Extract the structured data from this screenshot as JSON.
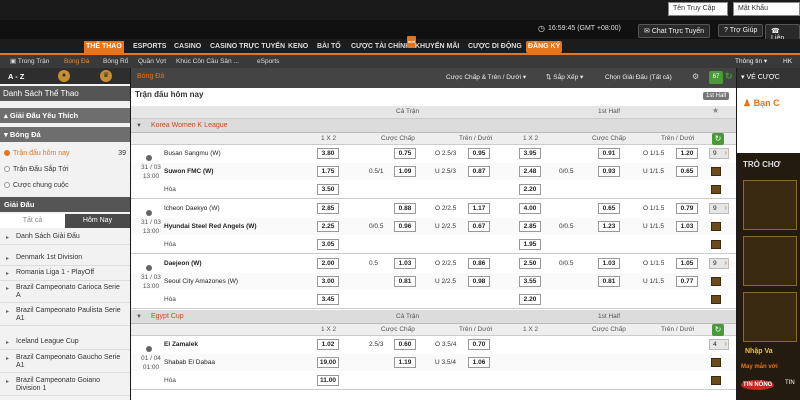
{
  "top": {
    "username_placeholder": "Tên Truy Cập",
    "password_placeholder": "Mật Khẩu",
    "clock": "16:59:45 (GMT +08:00)",
    "live_chat": "Chat Trực Tuyến",
    "help": "Trợ Giúp",
    "contact": "Liên Hệ"
  },
  "nav": {
    "items": [
      "THỂ THAO",
      "ESPORTS",
      "CASINO",
      "CASINO TRỰC TUYẾN",
      "KENO",
      "BÀI TỐ",
      "CƯỢC TÀI CHÍNH",
      "KHUYẾN MÃI",
      "CƯỢC DI ĐỘNG",
      "ĐĂNG KÝ"
    ],
    "new_badge": "mới"
  },
  "subnav": {
    "items": [
      "Trong Trận",
      "Bóng Đá",
      "Bóng Rổ",
      "Quần Vợt",
      "Khúc Côn Cầu Sân ...",
      "eSports"
    ],
    "info": "Thông tin",
    "odds_type": "HK"
  },
  "sidebar": {
    "az": "A - Z",
    "title": "Danh Sách Thể Thao",
    "favorites": "Giải Đấu Yêu Thích",
    "sport": "Bóng Đá",
    "options": [
      {
        "label": "Trận đấu hôm nay",
        "count": "39"
      },
      {
        "label": "Trận Đấu Sắp Tới",
        "count": ""
      },
      {
        "label": "Cược chung cuộc",
        "count": ""
      }
    ],
    "league_section": "Giải Đấu",
    "tabs": [
      "Tất cả",
      "Hôm Nay"
    ],
    "leagues": [
      "Danh Sách Giải Đấu",
      "Denmark 1st Division",
      "Romania Liga 1 - PlayOff",
      "Brazil Campeonato Carioca Serie A",
      "Brazil Campeonato Paulista Serie A1",
      "Iceland League Cup",
      "Brazil Campeonato Gaucho Serie A1",
      "Brazil Campeonato Goiano Division 1"
    ]
  },
  "main": {
    "sport_title": "Bóng Đá",
    "market_select": "Cược Chấp & Trên / Dưới",
    "sort": "Sắp Xếp",
    "league_select": "Chọn Giải Đấu (Tất cả)",
    "count_badge": "67",
    "day_title": "Trận đấu hôm nay",
    "half_btn": "1st Half",
    "full_time": "Cả Trận",
    "first_half": "1st Half",
    "cols": [
      "1 X 2",
      "Cược Chấp",
      "Trên / Dưới",
      "1 X 2",
      "Cược Chấp",
      "Trên / Dưới"
    ],
    "leagues": [
      {
        "name": "Korea Women K League",
        "matches": [
          {
            "date": "31 / 03",
            "time": "13:00",
            "home": "Busan Sangmu (W)",
            "away": "Suwon FMC (W)",
            "fav": "away",
            "ft1": "3.80",
            "ft2": "1.75",
            "ftx": "3.50",
            "fthcp": "0.5/1",
            "fthcp_h": "0.75",
            "fthcp_a": "1.09",
            "ftou": "2.5/3",
            "ftou_o": "0.95",
            "ftou_u": "0.87",
            "h1": "3.95",
            "h2": "2.48",
            "hx": "2.20",
            "hhcp": "0/0.5",
            "hhcp_h": "0.91",
            "hhcp_a": "0.93",
            "hou": "1/1.5",
            "hou_o": "1.20",
            "hou_u": "0.65",
            "more": "9"
          },
          {
            "date": "31 / 03",
            "time": "13:00",
            "home": "Icheon Daekyo (W)",
            "away": "Hyundai Steel Red Angels (W)",
            "fav": "away",
            "ft1": "2.85",
            "ft2": "2.25",
            "ftx": "3.05",
            "fthcp": "0/0.5",
            "fthcp_h": "0.88",
            "fthcp_a": "0.96",
            "ftou": "2/2.5",
            "ftou_o": "1.17",
            "ftou_u": "0.67",
            "h1": "4.00",
            "h2": "2.85",
            "hx": "1.95",
            "hhcp": "0/0.5",
            "hhcp_h": "0.65",
            "hhcp_a": "1.23",
            "hou": "1/1.5",
            "hou_o": "0.79",
            "hou_u": "1.03",
            "more": "9"
          },
          {
            "date": "31 / 03",
            "time": "13:00",
            "home": "Daejeon (W)",
            "away": "Seoul City Amazones (W)",
            "fav": "home",
            "ft1": "2.00",
            "ft2": "3.00",
            "ftx": "3.45",
            "fthcp": "0.5",
            "fthcp_h": "1.03",
            "fthcp_a": "0.81",
            "ftou": "2/2.5",
            "ftou_o": "0.86",
            "ftou_u": "0.98",
            "h1": "2.50",
            "h2": "3.55",
            "hx": "2.20",
            "hhcp": "0/0.5",
            "hhcp_h": "1.03",
            "hhcp_a": "0.81",
            "hou": "1/1.5",
            "hou_o": "1.05",
            "hou_u": "0.77",
            "more": "9"
          }
        ]
      },
      {
        "name": "Egypt Cup",
        "matches": [
          {
            "date": "01 / 04",
            "time": "01:00",
            "home": "El Zamalek",
            "away": "Shabab El Dabaa",
            "fav": "home",
            "ft1": "1.02",
            "ft2": "19.00",
            "ftx": "11.00",
            "fthcp": "2.5/3",
            "fthcp_h": "0.60",
            "fthcp_a": "1.19",
            "ftou": "3.5/4",
            "ftou_o": "0.70",
            "ftou_u": "1.06",
            "more": "4"
          }
        ]
      }
    ]
  },
  "right": {
    "title": "VÉ CƯỢC",
    "banner": "Bạn C",
    "promo_title": "TRÒ CHƠ",
    "labels": [
      "Nhập Va",
      "May mắn với",
      "TIN NÓNG",
      "TIN"
    ]
  },
  "colors": {
    "accent": "#e8741a",
    "league_name": "#c84b1f",
    "live_green": "#4a9a3a"
  }
}
